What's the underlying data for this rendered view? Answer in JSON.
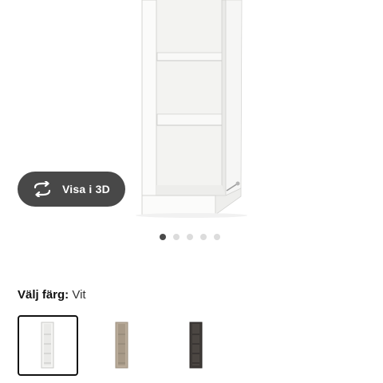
{
  "viewer": {
    "visa_3d_label": "Visa i 3D",
    "visa_3d_icon": "rotate-3d-icon",
    "dots": [
      {
        "active": true
      },
      {
        "active": false
      },
      {
        "active": false
      },
      {
        "active": false
      },
      {
        "active": false
      }
    ]
  },
  "color_picker": {
    "label": "Välj färg:",
    "selected_value": "Vit",
    "options": [
      {
        "name": "white",
        "color": "#f4f4f2",
        "selected": true
      },
      {
        "name": "beige",
        "color": "#b9ab99",
        "selected": false
      },
      {
        "name": "brown-black",
        "color": "#3e3a37",
        "selected": false
      }
    ]
  },
  "colors": {
    "button_bg": "#484848",
    "dot_active": "#4a4a4a",
    "dot_inactive": "#dcdcdc"
  }
}
